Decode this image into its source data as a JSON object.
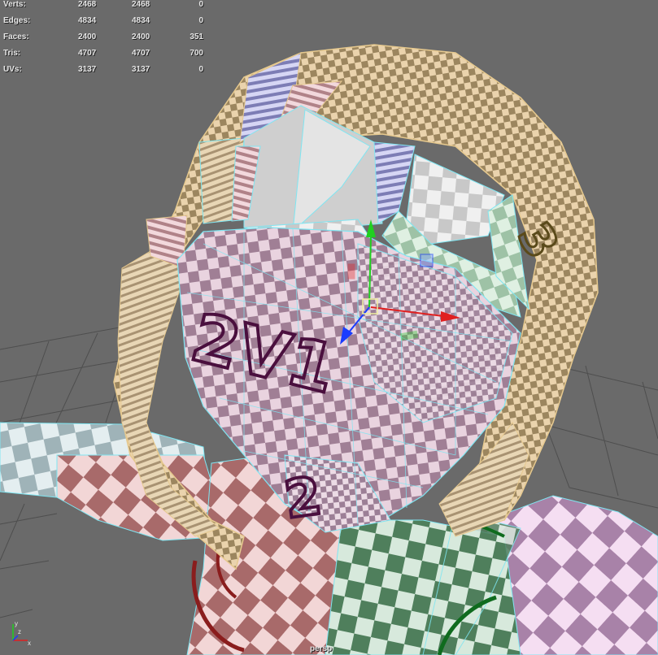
{
  "hud": {
    "rows": [
      {
        "label": "Verts:",
        "v1": "2468",
        "v2": "2468",
        "v3": "0"
      },
      {
        "label": "Edges:",
        "v1": "4834",
        "v2": "4834",
        "v3": "0"
      },
      {
        "label": "Faces:",
        "v1": "2400",
        "v2": "2400",
        "v3": "351"
      },
      {
        "label": "Tris:",
        "v1": "4707",
        "v2": "4707",
        "v3": "700"
      },
      {
        "label": "UVs:",
        "v1": "3137",
        "v2": "3137",
        "v3": "0"
      }
    ]
  },
  "viewport": {
    "camera": "persp",
    "uv_labels": {
      "face": "2V1",
      "neck": "2",
      "hair": "3"
    }
  },
  "axis_indicator": {
    "x": "x",
    "y": "y",
    "z": "z"
  },
  "colors": {
    "background": "#6a6a6a",
    "grid": "#4e4e4e",
    "wireframe": "#7fe6f2",
    "manip_x": "#e02020",
    "manip_y": "#20d020",
    "manip_z": "#1a3cff"
  }
}
